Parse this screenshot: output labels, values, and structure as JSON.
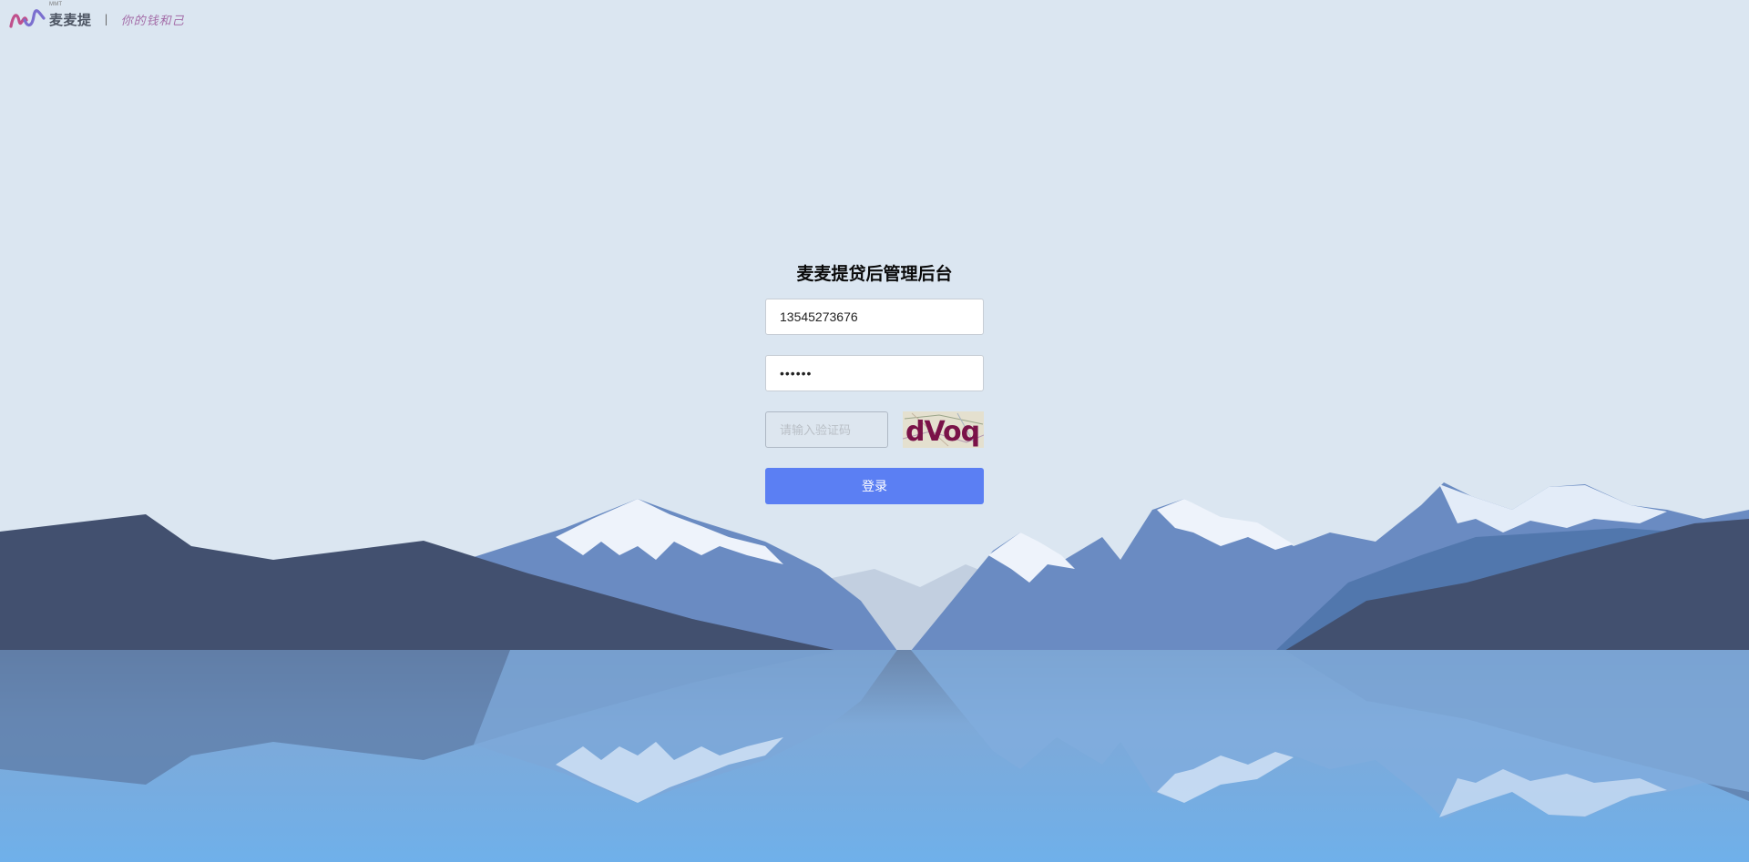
{
  "header": {
    "brand_small": "MMT",
    "brand_name": "麦麦提",
    "separator": "|",
    "slogan": "你的钱和己",
    "logo_icon": "mmt-wave-logo-icon"
  },
  "login": {
    "title": "麦麦提贷后管理后台",
    "phone_value": "13545273676",
    "password_value": "••••••",
    "captcha_placeholder": "请输入验证码",
    "captcha_text": "dVoq",
    "submit_label": "登录"
  },
  "background": {
    "scene": "mountain-lake",
    "colors": {
      "sky": "#dbe6f1",
      "dark_mountain": "#42506f",
      "mid_mountain": "#6a8bc2",
      "snow": "#eef3fb",
      "lake": "#78b0e5",
      "button": "#5b7ff3"
    }
  }
}
